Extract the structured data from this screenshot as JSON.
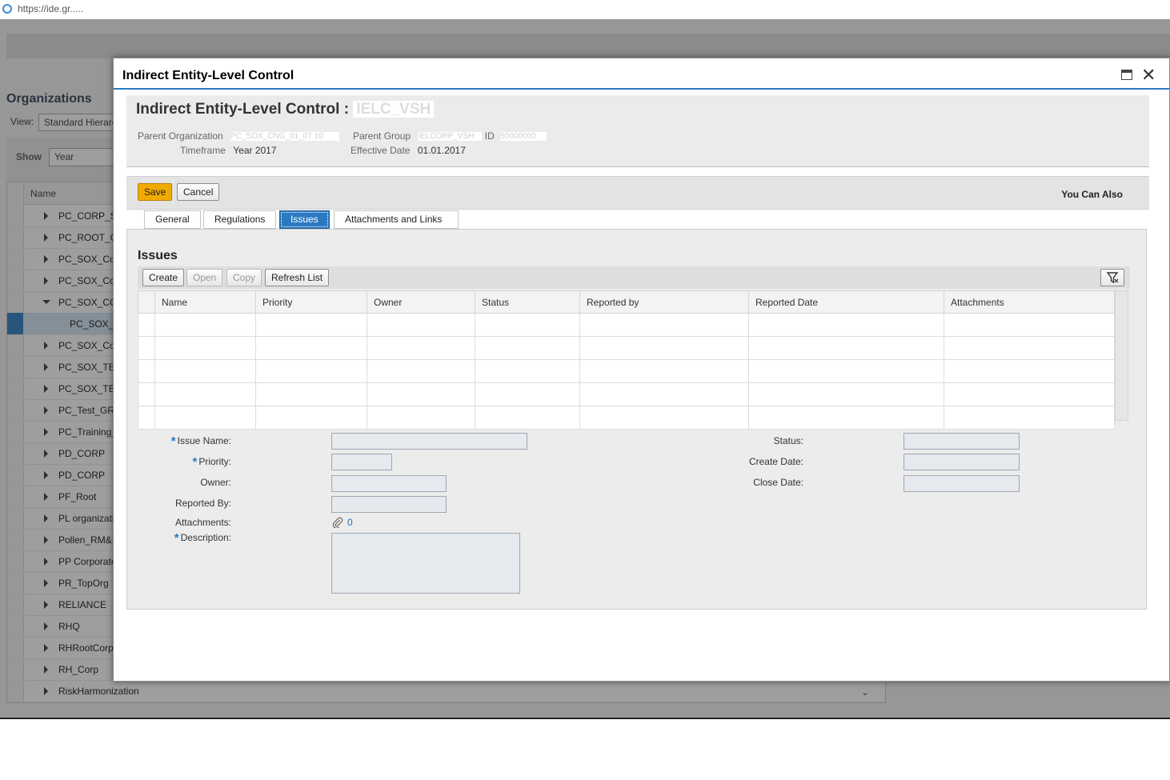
{
  "browser": {
    "url": "https://ide.gr....."
  },
  "background": {
    "panel_title": "Organizations",
    "view_label": "View:",
    "view_value": "Standard Hierarc",
    "show_label": "Show",
    "show_value": "Year",
    "tree_header": "Name",
    "tree_rows": [
      {
        "label": "PC_CORP_S",
        "expanded": false
      },
      {
        "label": "PC_ROOT_C",
        "expanded": false
      },
      {
        "label": "PC_SOX_Co",
        "expanded": false
      },
      {
        "label": "PC_SOX_Co",
        "expanded": false
      },
      {
        "label": "PC_SOX_CO",
        "expanded": true
      },
      {
        "label": "PC_SOX_",
        "selected": true
      },
      {
        "label": "PC_SOX_Co",
        "expanded": false
      },
      {
        "label": "PC_SOX_TE",
        "expanded": false
      },
      {
        "label": "PC_SOX_TE",
        "expanded": false
      },
      {
        "label": "PC_Test_GR",
        "expanded": false
      },
      {
        "label": "PC_Training_",
        "expanded": false
      },
      {
        "label": "PD_CORP",
        "expanded": false
      },
      {
        "label": "PD_CORP",
        "expanded": false
      },
      {
        "label": "PF_Root",
        "expanded": false
      },
      {
        "label": "PL organizati",
        "expanded": false
      },
      {
        "label": "Pollen_RM&I",
        "expanded": false
      },
      {
        "label": "PP Corporate",
        "expanded": false
      },
      {
        "label": "PR_TopOrg",
        "expanded": false
      },
      {
        "label": "RELIANCE",
        "expanded": false
      },
      {
        "label": "RHQ",
        "expanded": false
      },
      {
        "label": "RHRootCorp",
        "expanded": false
      },
      {
        "label": "RH_Corp",
        "expanded": false
      },
      {
        "label": "RiskHarmonization",
        "expanded": false
      }
    ]
  },
  "dialog": {
    "title": "Indirect Entity-Level Control",
    "header": {
      "object_title_prefix": "Indirect Entity-Level Control : ",
      "object_id_masked": "IELC_VSH",
      "parent_org_label": "Parent Organization",
      "parent_org_value": "PC_SOX_CNG_01_07 10",
      "parent_group_label": "Parent Group",
      "parent_group_value": "IELCORP_VSH",
      "id_label": "ID",
      "id_value": "50000000",
      "timeframe_label": "Timeframe",
      "timeframe_value": "Year 2017",
      "effective_label": "Effective Date",
      "effective_value": "01.01.2017"
    },
    "actions": {
      "save": "Save",
      "cancel": "Cancel",
      "you_can_also": "You Can Also"
    },
    "tabs": [
      {
        "label": "General",
        "active": false
      },
      {
        "label": "Regulations",
        "active": false
      },
      {
        "label": "Issues",
        "active": true
      },
      {
        "label": "Attachments and Links",
        "active": false
      }
    ],
    "issues": {
      "section_title": "Issues",
      "toolbar": {
        "create": "Create",
        "open": "Open",
        "copy": "Copy",
        "refresh": "Refresh List"
      },
      "columns": [
        "Name",
        "Priority",
        "Owner",
        "Status",
        "Reported by",
        "Reported Date",
        "Attachments"
      ],
      "row_count": 5
    },
    "form": {
      "issue_name_label": "Issue Name:",
      "priority_label": "Priority:",
      "owner_label": "Owner:",
      "reported_by_label": "Reported By:",
      "attachments_label": "Attachments:",
      "attachments_count": "0",
      "description_label": "Description:",
      "status_label": "Status:",
      "create_date_label": "Create Date:",
      "close_date_label": "Close Date:",
      "required_mark": "*"
    }
  },
  "colors": {
    "accent": "#2b7ac1",
    "save_button": "#f0ab00",
    "required": "#2b7ac1"
  }
}
